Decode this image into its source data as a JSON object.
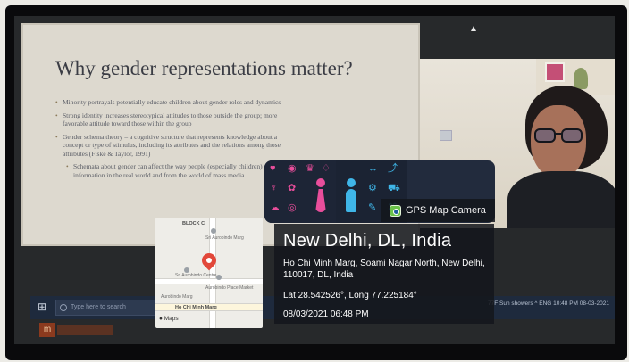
{
  "slide": {
    "title": "Why gender representations matter?",
    "bullets": [
      {
        "text": "Minority portrayals potentially educate children about gender roles and dynamics",
        "sub": false
      },
      {
        "text": "Strong identity increases stereotypical attitudes to those outside the group; more favorable attitude toward those within the group",
        "sub": false
      },
      {
        "text": "Gender schema theory – a cognitive structure that represents knowledge about a concept or type of stimulus, including its attributes and the relations among those attributes (Fiske & Taylor, 1991)",
        "sub": false
      },
      {
        "text": "Schemata about gender can affect the way people (especially children) process information in the real world and from the world of mass media",
        "sub": true
      }
    ]
  },
  "taskbar": {
    "search_placeholder": "Type here to search",
    "tray_text": "77F Sun showers ^ ENG 10:48 PM 08-03-2021"
  },
  "map": {
    "labels": {
      "block": "BLOCK C",
      "poi1": "Sri Aurobindo Marg",
      "poi2": "Sri Aurobindo Centre",
      "poi3": "Aurobindo Place Market",
      "road": "Ho Chi Minh Marg",
      "road2": "Aurobindo Marg",
      "brand": "Maps"
    }
  },
  "geotag": {
    "app_name": "GPS Map Camera",
    "city": "New Delhi, DL, India",
    "address": "Ho Chi Minh Marg, Soami Nagar North, New Delhi, 110017, DL, India",
    "coordinates": "Lat 28.542526°, Long 77.225184°",
    "datetime": "08/03/2021 06:48 PM"
  },
  "colors": {
    "pin": "#e2483a",
    "overlay": "#14161c",
    "icon_pink": "#e94e9b",
    "icon_blue": "#3fb6e8"
  },
  "icons": [
    "windows-start-icon",
    "search-icon",
    "map-pin-icon",
    "gps-camera-icon",
    "female-figure-icon",
    "male-figure-icon"
  ]
}
